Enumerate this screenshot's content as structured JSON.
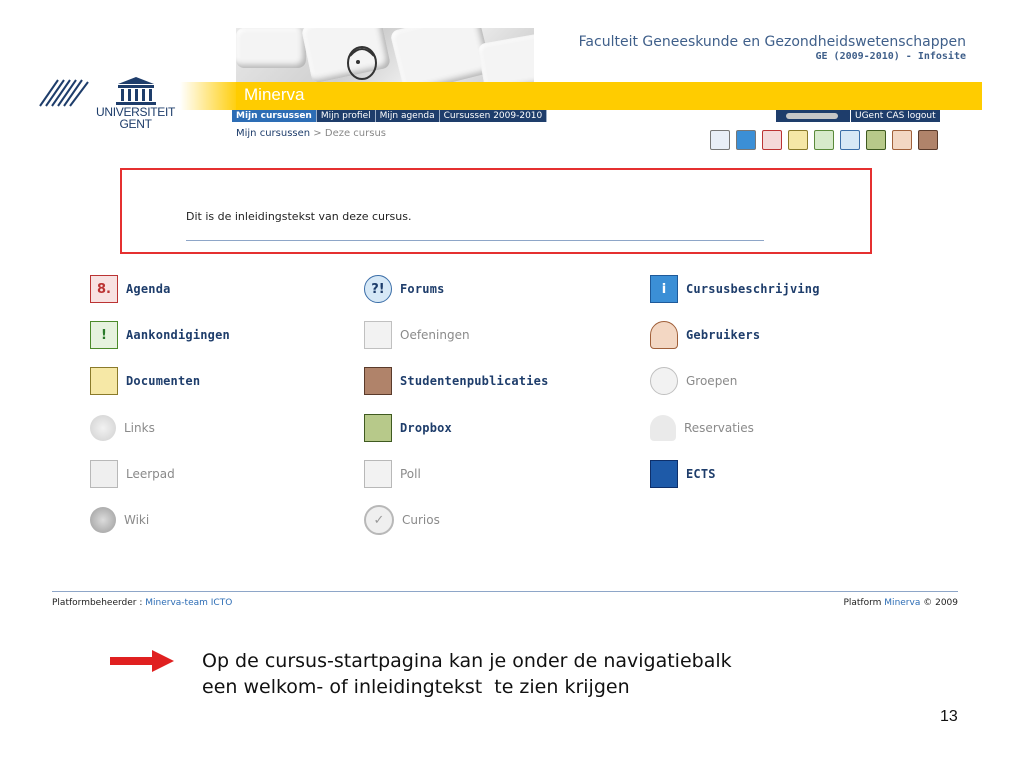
{
  "header": {
    "faculty": "Faculteit Geneeskunde en Gezondheidswetenschappen",
    "faculty_sub": "GE (2009-2010) - Infosite",
    "app_title": "Minerva",
    "logo_line1": "UNIVERSITEIT",
    "logo_line2": "GENT",
    "colors": {
      "brand_blue": "#1e3d6b",
      "accent_yellow": "#ffcc00",
      "tab_active": "#2d6db5"
    }
  },
  "nav": {
    "tabs": [
      {
        "label": "Mijn cursussen"
      },
      {
        "label": "Mijn profiel"
      },
      {
        "label": "Mijn agenda"
      },
      {
        "label": "Cursussen 2009-2010"
      }
    ],
    "breadcrumb": {
      "parent": "Mijn cursussen",
      "separator": ">",
      "current": "Deze cursus"
    },
    "logout_label": "UGent CAS logout"
  },
  "intro": {
    "text": "Dit is de inleidingstekst van deze cursus."
  },
  "tools": [
    {
      "label": "Agenda",
      "icon": "calendar-icon",
      "active": true
    },
    {
      "label": "Forums",
      "icon": "forum-icon",
      "active": true
    },
    {
      "label": "Cursusbeschrijving",
      "icon": "info-icon",
      "active": true
    },
    {
      "label": "Aankondigingen",
      "icon": "announcement-icon",
      "active": true
    },
    {
      "label": "Oefeningen",
      "icon": "exercise-icon",
      "active": false
    },
    {
      "label": "Gebruikers",
      "icon": "users-icon",
      "active": true
    },
    {
      "label": "Documenten",
      "icon": "folder-icon",
      "active": true
    },
    {
      "label": "Studentenpublicaties",
      "icon": "publication-icon",
      "active": true
    },
    {
      "label": "Groepen",
      "icon": "groups-icon",
      "active": false
    },
    {
      "label": "Links",
      "icon": "links-icon",
      "active": false
    },
    {
      "label": "Dropbox",
      "icon": "dropbox-icon",
      "active": true
    },
    {
      "label": "Reservaties",
      "icon": "reservation-bell-icon",
      "active": false
    },
    {
      "label": "Leerpad",
      "icon": "learning-path-icon",
      "active": false
    },
    {
      "label": "Poll",
      "icon": "poll-icon",
      "active": false
    },
    {
      "label": "ECTS",
      "icon": "ects-icon",
      "active": true
    },
    {
      "label": "Wiki",
      "icon": "wiki-globe-icon",
      "active": false
    },
    {
      "label": "Curios",
      "icon": "curios-check-icon",
      "active": false
    }
  ],
  "footer": {
    "left_prefix": "Platformbeheerder :",
    "left_link": "Minerva-team ICTO",
    "right_prefix": "Platform",
    "right_link": "Minerva",
    "right_suffix": "© 2009"
  },
  "slide": {
    "caption_line1": "Op de cursus-startpagina kan je onder de navigatiebalk",
    "caption_line2": "een welkom- of inleidingtekst  te zien krijgen",
    "page_number": "13"
  }
}
